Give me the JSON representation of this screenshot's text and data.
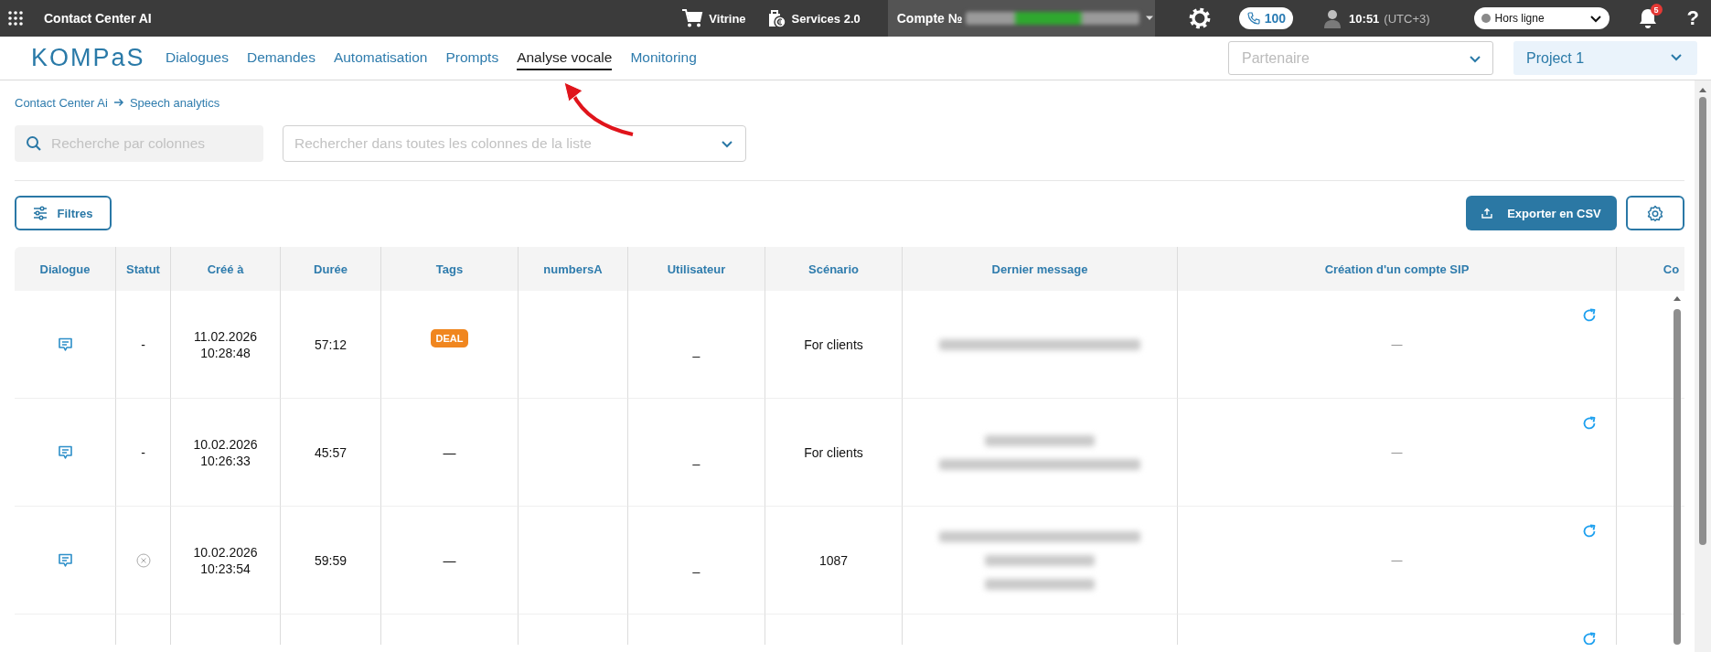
{
  "topbar": {
    "app_title": "Contact Center AI",
    "links": [
      {
        "label": "Vitrine",
        "kind": "cart"
      },
      {
        "label": "Services 2.0",
        "kind": "services"
      }
    ],
    "account": {
      "label": "Compte №",
      "redacted": true
    },
    "calls": "100",
    "time": "10:51",
    "timezone": "(UTC+3)",
    "status": {
      "label": "Hors ligne",
      "color": "#8a8a8a"
    },
    "notifications": "5",
    "help": "?"
  },
  "nav": {
    "logo": "KOMPaS",
    "items": [
      {
        "label": "Dialogues",
        "selected": false
      },
      {
        "label": "Demandes",
        "selected": false
      },
      {
        "label": "Automatisation",
        "selected": false
      },
      {
        "label": "Prompts",
        "selected": false
      },
      {
        "label": "Analyse vocale",
        "selected": true
      },
      {
        "label": "Monitoring",
        "selected": false
      }
    ],
    "partner": {
      "placeholder": "Partenaire"
    },
    "project": {
      "value": "Project 1"
    }
  },
  "annotation": {
    "kind": "arrow"
  },
  "breadcrumb": [
    "Contact Center Ai",
    "Speech analytics"
  ],
  "search": {
    "placeholder": "Recherche par colonnes"
  },
  "column_search": {
    "placeholder": "Rechercher dans toutes les colonnes de la liste"
  },
  "filters_button": "Filtres",
  "export_button": "Exporter en CSV",
  "table": {
    "columns": [
      "Dialogue",
      "Statut",
      "Créé à",
      "Durée",
      "Tags",
      "numbersA",
      "Utilisateur",
      "Scénario",
      "Dernier message",
      "Création d'un compte SIP",
      "Co"
    ],
    "rows": [
      {
        "kind": "full",
        "dialogue": {
          "kind": "chat"
        },
        "status": {
          "kind": "text",
          "text": "-"
        },
        "created": "11.02.2026 10:28:48",
        "duration": "57:12",
        "tags": {
          "kind": "badge",
          "text": "DEAL",
          "color": "#f0861f"
        },
        "user": "_",
        "scenario": "For clients",
        "last_message": [
          {
            "kind": "redacted"
          }
        ],
        "sip": {
          "value": "—",
          "refresh": true
        }
      },
      {
        "kind": "full",
        "dialogue": {
          "kind": "chat"
        },
        "status": {
          "kind": "text",
          "text": "-"
        },
        "created": "10.02.2026 10:26:33",
        "duration": "45:57",
        "tags": {
          "kind": "text",
          "text": "—"
        },
        "user": "_",
        "scenario": "For clients",
        "last_message": [
          {
            "kind": "redacted_short"
          },
          {
            "kind": "redacted"
          }
        ],
        "sip": {
          "value": "—",
          "refresh": true
        }
      },
      {
        "kind": "full",
        "dialogue": {
          "kind": "chat"
        },
        "status": {
          "kind": "cancelled"
        },
        "created": "10.02.2026 10:23:54",
        "duration": "59:59",
        "tags": {
          "kind": "text",
          "text": "—"
        },
        "user": "_",
        "scenario": "1087",
        "last_message": [
          {
            "kind": "redacted"
          },
          {
            "kind": "redacted_short"
          },
          {
            "kind": "redacted_short"
          }
        ],
        "sip": {
          "value": "—",
          "refresh": true
        }
      },
      {
        "kind": "cut",
        "sip": {
          "refresh": true
        }
      }
    ]
  }
}
